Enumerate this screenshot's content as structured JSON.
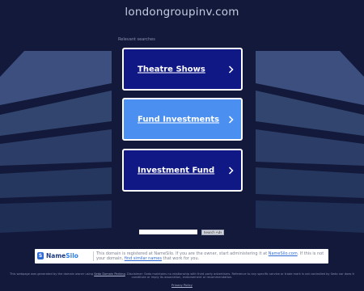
{
  "header": {
    "domain": "londongroupinv.com"
  },
  "section_label": "Relevant searches",
  "results": [
    {
      "label": "Theatre Shows"
    },
    {
      "label": "Fund Investments"
    },
    {
      "label": "Investment Fund"
    }
  ],
  "search": {
    "input_value": "",
    "button_label": "Search Ads"
  },
  "footer": {
    "brand_icon": "namesilo-logo",
    "brand_name_part1": "Name",
    "brand_name_part2": "Silo",
    "message_part1": "This domain is registered at NameSilo. If you are the owner, start administering it at ",
    "message_link1": "NameSilo.com",
    "message_part2": ". If this is not your domain, ",
    "message_link2": "find similar names",
    "message_part3": " that work for you."
  },
  "disclaimer": {
    "part1": "This webpage was generated by the domain owner using ",
    "link": "Sedo Domain Parking",
    "part2": ". Disclaimer: Sedo maintains no relationship with third party advertisers. Reference to any specific service or trade mark is not controlled by Sedo nor does it constitute or imply its association, endorsement or recommendation."
  },
  "privacy_link": "Privacy Policy",
  "colors": {
    "background": "#12193a",
    "card": "#101886",
    "card_active": "#4b8ff0",
    "decor_light": "#3a4d7c",
    "decor_dark": "#243461"
  }
}
